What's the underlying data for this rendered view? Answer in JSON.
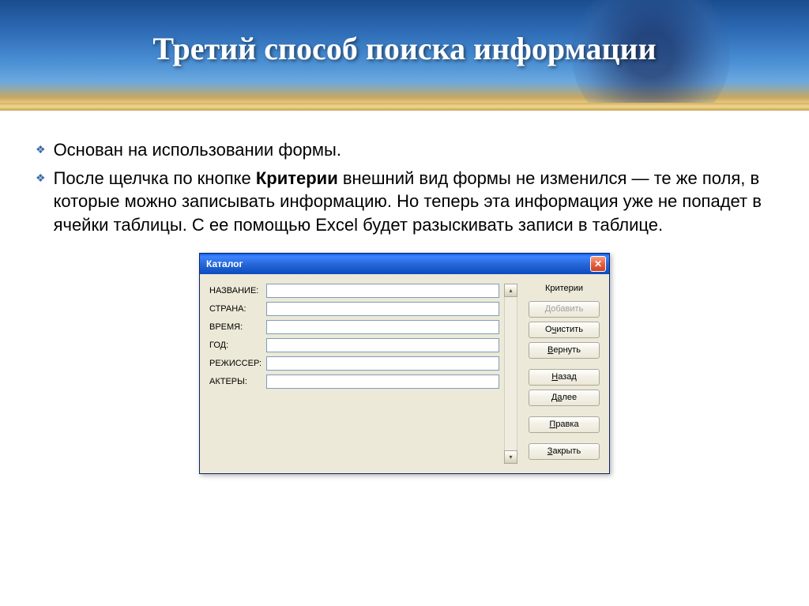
{
  "slide": {
    "title": "Третий способ поиска информации",
    "bullet1": "Основан на использовании формы.",
    "bullet2_prefix": "После щелчка по кнопке ",
    "bullet2_bold": "Критерии",
    "bullet2_suffix": " внешний вид формы не изменился — те же поля, в которые можно записывать информацию. Но теперь эта информация уже не попадет в ячейки таблицы. С ее помощью Excel будет разыскивать записи в таблице."
  },
  "dialog": {
    "title": "Каталог",
    "status": "Критерии",
    "fields": [
      {
        "label": "НАЗВАНИЕ:",
        "value": ""
      },
      {
        "label": "СТРАНА:",
        "value": ""
      },
      {
        "label": "ВРЕМЯ:",
        "value": ""
      },
      {
        "label": "ГОД:",
        "value": ""
      },
      {
        "label": "РЕЖИССЕР:",
        "value": ""
      },
      {
        "label": "АКТЕРЫ:",
        "value": ""
      }
    ],
    "buttons": {
      "add": "Добавить",
      "clear": "Очистить",
      "restore": "Вернуть",
      "back": "Назад",
      "next": "Далее",
      "edit": "Правка",
      "close": "Закрыть"
    }
  }
}
